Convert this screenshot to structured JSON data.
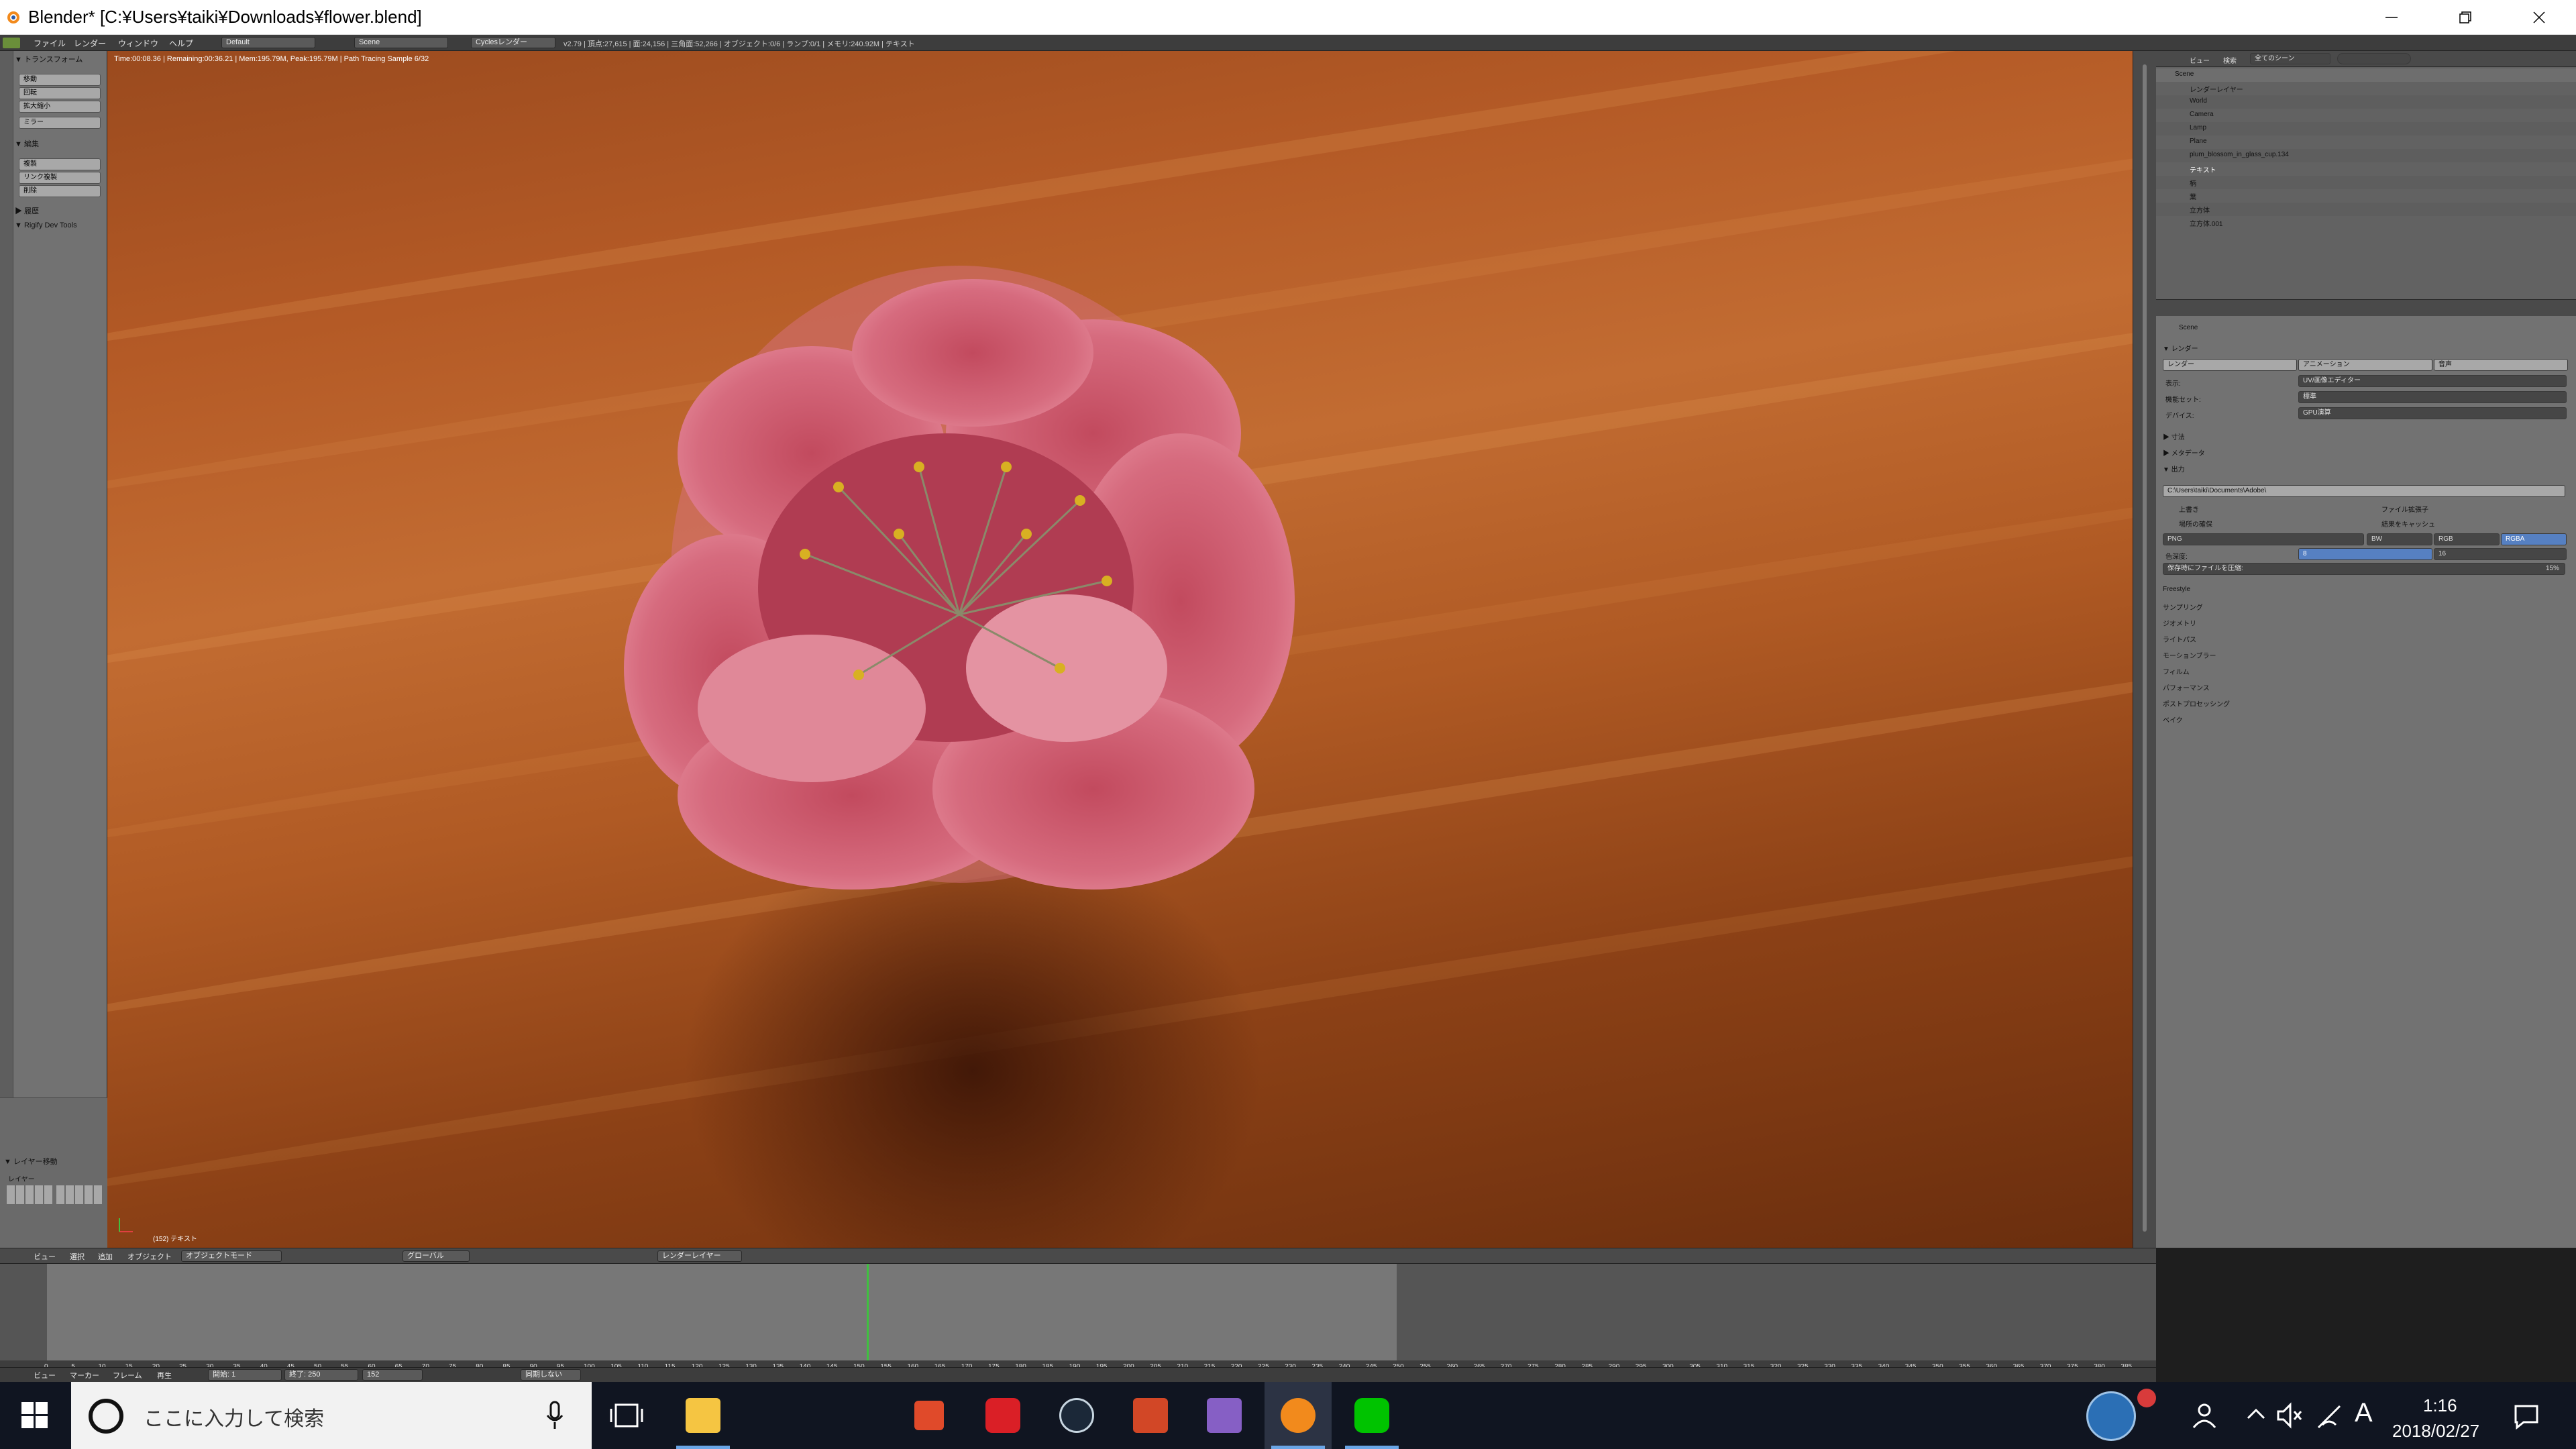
{
  "window": {
    "title": "Blender* [C:¥Users¥taiki¥Downloads¥flower.blend]",
    "controls": [
      "minimize-icon",
      "restore-icon",
      "close-icon"
    ]
  },
  "infobar": {
    "menus": [
      "ファイル",
      "レンダー",
      "ウィンドウ",
      "ヘルプ"
    ],
    "layout": "Default",
    "scene": "Scene",
    "engine": "Cyclesレンダー",
    "stats": "v2.79 | 頂点:27,615 | 面:24,156 | 三角面:52,266 | オブジェクト:0/6 | ランプ:0/1 | メモリ:240.92M | テキスト"
  },
  "toolshelf": {
    "transform_header": "▼ トランスフォーム",
    "transform_buttons": [
      "移動",
      "回転",
      "拡大縮小",
      "ミラー"
    ],
    "edit_header": "▼ 編集",
    "edit_buttons": [
      "複製",
      "リンク複製",
      "削除"
    ],
    "history_header": "▶ 履歴",
    "rigify_header": "▼ Rigify Dev Tools",
    "layer_header": "▼ レイヤー移動",
    "layer_label": "レイヤー"
  },
  "viewport": {
    "render_status": "Time:00:08.36 | Remaining:00:36.21 | Mem:195.79M, Peak:195.79M | Path Tracing Sample 6/32",
    "object_label": "(152) テキスト"
  },
  "outliner": {
    "view": "ビュー",
    "search_label": "検索",
    "filter": "全てのシーン",
    "rows": [
      "Scene",
      "レンダーレイヤー",
      "World",
      "Camera",
      "Lamp",
      "Plane",
      "plum_blossom_in_glass_cup.134",
      "テキスト",
      "柄",
      "葉",
      "立方体",
      "立方体.001"
    ]
  },
  "properties": {
    "scene": "Scene",
    "render_header": "▼ レンダー",
    "render_tabs": [
      "レンダー",
      "アニメーション",
      "音声"
    ],
    "display_label": "表示:",
    "display_value": "UV/画像エディター",
    "feature_label": "機能セット:",
    "feature_value": "標準",
    "device_label": "デバイス:",
    "device_value": "GPU演算",
    "dimensions": "▶ 寸法",
    "metadata": "▶ メタデータ",
    "output_header": "▼ 出力",
    "output_path": "C:\\Users\\taiki\\Documents\\Adobe\\",
    "overwrite": "上書き",
    "file_ext": "ファイル拡張子",
    "placeholders": "場所の確保",
    "cache": "結果をキャッシュ",
    "format": "PNG",
    "color_modes": [
      "BW",
      "RGB",
      "RGBA"
    ],
    "depth_label": "色深度:",
    "depth_values": [
      "8",
      "16"
    ],
    "compression": "保存時にファイルを圧縮:",
    "compression_value": "15%",
    "panels": [
      "Freestyle",
      "サンプリング",
      "ジオメトリ",
      "ライトパス",
      "モーションブラー",
      "フィルム",
      "パフォーマンス",
      "ポストプロセッシング",
      "ベイク"
    ]
  },
  "viewport_header": {
    "menus": [
      "ビュー",
      "選択",
      "追加",
      "オブジェクト"
    ],
    "mode": "オブジェクトモード",
    "orientation": "グローバル",
    "render_layer": "レンダーレイヤー"
  },
  "timeline": {
    "ticks": [
      "0",
      "5",
      "10",
      "15",
      "20",
      "25",
      "30",
      "35",
      "40",
      "45",
      "50",
      "55",
      "60",
      "65",
      "70",
      "75",
      "80",
      "85",
      "90",
      "95",
      "100",
      "105",
      "110",
      "115",
      "120",
      "125",
      "130",
      "135",
      "140",
      "145",
      "150",
      "155",
      "160",
      "165",
      "170",
      "175",
      "180",
      "185",
      "190",
      "195",
      "200",
      "205",
      "210",
      "215",
      "220",
      "225",
      "230",
      "235",
      "240",
      "245",
      "250",
      "255",
      "260",
      "265",
      "270",
      "275",
      "280",
      "285",
      "290",
      "295",
      "300",
      "305",
      "310",
      "315",
      "320",
      "325",
      "330",
      "335",
      "340",
      "345",
      "350",
      "355",
      "360",
      "365",
      "370",
      "375",
      "380",
      "385"
    ],
    "current_frame": 152,
    "menus": [
      "ビュー",
      "マーカー",
      "フレーム",
      "再生"
    ],
    "start": "開始:",
    "start_value": "1",
    "end": "終了:",
    "end_value": "250",
    "frame_value": "152",
    "sync": "同期しない"
  },
  "taskbar": {
    "search_placeholder": "ここに入力して検索",
    "apps": [
      "file-explorer-icon",
      "scratch-app-icon",
      "creative-cloud-icon",
      "steam-icon",
      "powerpoint-icon",
      "visual-studio-icon",
      "blender-icon",
      "line-icon"
    ],
    "time": "1:16",
    "date": "2018/02/27",
    "ime": "A"
  }
}
